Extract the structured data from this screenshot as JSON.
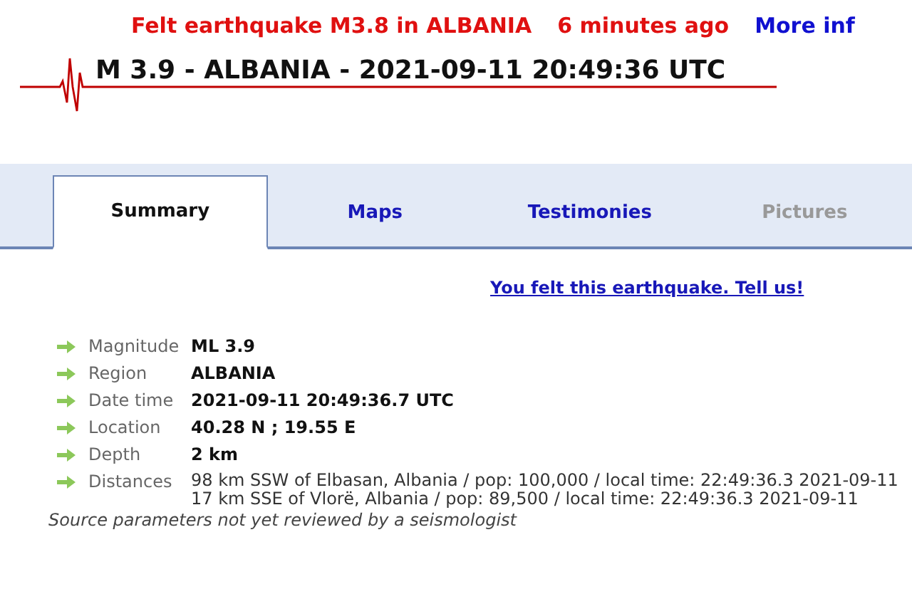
{
  "banner": {
    "alert": "Felt earthquake M3.8 in ALBANIA",
    "time": "6 minutes ago",
    "link": "More inf"
  },
  "title": "M 3.9 - ALBANIA - 2021-09-11 20:49:36 UTC",
  "tabs": [
    {
      "label": "Summary",
      "selected": true,
      "disabled": false
    },
    {
      "label": "Maps",
      "selected": false,
      "disabled": false
    },
    {
      "label": "Testimonies",
      "selected": false,
      "disabled": false
    },
    {
      "label": "Pictures",
      "selected": false,
      "disabled": true
    }
  ],
  "felt_link": "You felt this earthquake. Tell us!",
  "details": [
    {
      "label": "Magnitude",
      "values": [
        "ML 3.9"
      ],
      "kind": "bold"
    },
    {
      "label": "Region",
      "values": [
        "ALBANIA"
      ],
      "kind": "bold"
    },
    {
      "label": "Date time",
      "values": [
        "2021-09-11 20:49:36.7 UTC"
      ],
      "kind": "bold"
    },
    {
      "label": "Location",
      "values": [
        "40.28 N ; 19.55 E"
      ],
      "kind": "bold"
    },
    {
      "label": "Depth",
      "values": [
        "2 km"
      ],
      "kind": "bold"
    },
    {
      "label": "Distances",
      "values": [
        "98 km SSW of Elbasan, Albania / pop: 100,000 / local time: 22:49:36.3 2021-09-11",
        "17 km SSE of Vlorë, Albania / pop: 89,500 / local time: 22:49:36.3 2021-09-11"
      ],
      "kind": "plain"
    }
  ],
  "note": "Source parameters not yet reviewed by a seismologist"
}
